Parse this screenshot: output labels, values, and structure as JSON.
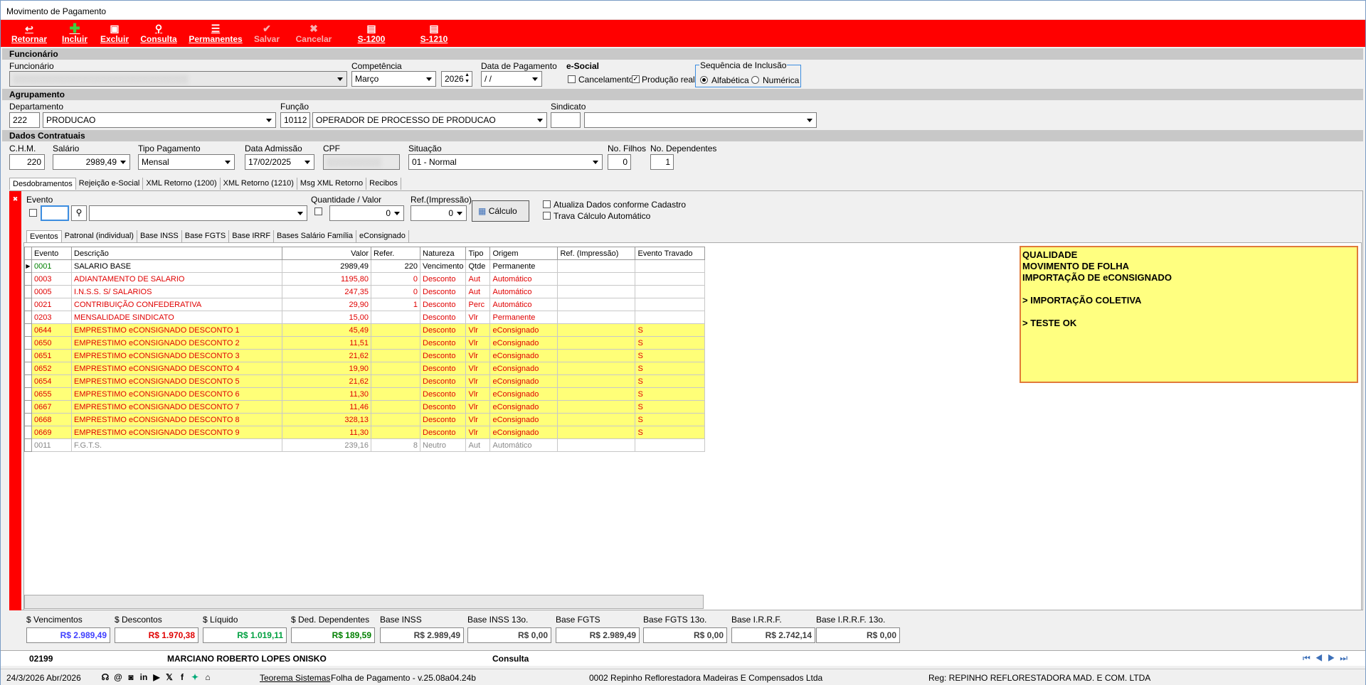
{
  "window": {
    "title": "Movimento de Pagamento"
  },
  "toolbar": {
    "items": [
      {
        "label": "Retornar",
        "icon": "return-icon"
      },
      {
        "label": "Incluir",
        "icon": "plus-icon"
      },
      {
        "label": "Excluir",
        "icon": "delete-icon"
      },
      {
        "label": "Consulta",
        "icon": "search-icon"
      },
      {
        "label": "Permanentes",
        "icon": "list-icon"
      },
      {
        "label": "Salvar",
        "icon": "check-icon"
      },
      {
        "label": "Cancelar",
        "icon": "cancel-icon"
      },
      {
        "label": "S-1200",
        "icon": "document-icon"
      },
      {
        "label": "S-1210",
        "icon": "document-icon"
      }
    ]
  },
  "funcionario": {
    "section": "Funcionário",
    "label": "Funcionário",
    "competencia_label": "Competência",
    "competencia": "Março",
    "ano": "2026",
    "data_pag_label": "Data de Pagamento",
    "data_pag": " /  /",
    "esocial_label": "e-Social",
    "cancelamento": "Cancelamento",
    "producao": "Produção real",
    "seq_label": "Sequência de Inclusão",
    "seq_alfa": "Alfabética",
    "seq_num": "Numérica"
  },
  "agrupamento": {
    "section": "Agrupamento",
    "dep_label": "Departamento",
    "dep_code": "222",
    "dep_name": "PRODUCAO",
    "funcao_label": "Função",
    "funcao_code": "10112",
    "funcao_name": "OPERADOR DE PROCESSO DE PRODUCAO",
    "sindicato_label": "Sindicato"
  },
  "contratuais": {
    "section": "Dados Contratuais",
    "chm_label": "C.H.M.",
    "chm": "220",
    "salario_label": "Salário",
    "salario": "2989,49",
    "tipo_label": "Tipo Pagamento",
    "tipo": "Mensal",
    "adm_label": "Data Admissão",
    "adm": "17/02/2025",
    "cpf_label": "CPF",
    "sit_label": "Situação",
    "sit": "01 - Normal",
    "filhos_label": "No. Filhos",
    "filhos": "0",
    "dep_label": "No. Dependentes",
    "dep": "1"
  },
  "tabs": [
    "Desdobramentos",
    "Rejeição e-Social",
    "XML Retorno (1200)",
    "XML Retorno (1210)",
    "Msg XML Retorno",
    "Recibos"
  ],
  "evento": {
    "label": "Evento",
    "qv_label": "Quantidade / Valor",
    "qv": "0",
    "ref_label": "Ref.(Impressão)",
    "ref": "0",
    "calc": "Cálculo",
    "atualiza": "Atualiza Dados conforme Cadastro",
    "trava": "Trava Cálculo Automático"
  },
  "subtabs": [
    "Eventos",
    "Patronal (individual)",
    "Base INSS",
    "Base FGTS",
    "Base IRRF",
    "Bases Salário Família",
    "eConsignado"
  ],
  "grid": {
    "headers": [
      "Evento",
      "Descrição",
      "Valor",
      "Refer.",
      "Natureza",
      "Tipo",
      "Origem",
      "Ref. (Impressão)",
      "Evento Travado"
    ],
    "rows": [
      [
        "0001",
        "SALARIO BASE",
        "2989,49",
        "220",
        "Vencimento",
        "Qtde",
        "Permanente",
        "",
        ""
      ],
      [
        "0003",
        "ADIANTAMENTO DE SALARIO",
        "1195,80",
        "0",
        "Desconto",
        "Aut",
        "Automático",
        "",
        ""
      ],
      [
        "0005",
        "I.N.S.S. S/ SALARIOS",
        "247,35",
        "0",
        "Desconto",
        "Aut",
        "Automático",
        "",
        ""
      ],
      [
        "0021",
        "CONTRIBUIÇÃO CONFEDERATIVA",
        "29,90",
        "1",
        "Desconto",
        "Perc",
        "Automático",
        "",
        ""
      ],
      [
        "0203",
        "MENSALIDADE SINDICATO",
        "15,00",
        "",
        "Desconto",
        "Vlr",
        "Permanente",
        "",
        ""
      ],
      [
        "0644",
        "EMPRESTIMO eCONSIGNADO DESCONTO  1",
        "45,49",
        "",
        "Desconto",
        "Vlr",
        "eConsignado",
        "",
        "S"
      ],
      [
        "0650",
        "EMPRESTIMO eCONSIGNADO DESCONTO  2",
        "11,51",
        "",
        "Desconto",
        "Vlr",
        "eConsignado",
        "",
        "S"
      ],
      [
        "0651",
        "EMPRESTIMO eCONSIGNADO DESCONTO  3",
        "21,62",
        "",
        "Desconto",
        "Vlr",
        "eConsignado",
        "",
        "S"
      ],
      [
        "0652",
        "EMPRESTIMO eCONSIGNADO DESCONTO  4",
        "19,90",
        "",
        "Desconto",
        "Vlr",
        "eConsignado",
        "",
        "S"
      ],
      [
        "0654",
        "EMPRESTIMO eCONSIGNADO DESCONTO  5",
        "21,62",
        "",
        "Desconto",
        "Vlr",
        "eConsignado",
        "",
        "S"
      ],
      [
        "0655",
        "EMPRESTIMO eCONSIGNADO DESCONTO  6",
        "11,30",
        "",
        "Desconto",
        "Vlr",
        "eConsignado",
        "",
        "S"
      ],
      [
        "0667",
        "EMPRESTIMO eCONSIGNADO DESCONTO  7",
        "11,46",
        "",
        "Desconto",
        "Vlr",
        "eConsignado",
        "",
        "S"
      ],
      [
        "0668",
        "EMPRESTIMO eCONSIGNADO DESCONTO  8",
        "328,13",
        "",
        "Desconto",
        "Vlr",
        "eConsignado",
        "",
        "S"
      ],
      [
        "0669",
        "EMPRESTIMO eCONSIGNADO DESCONTO  9",
        "11,30",
        "",
        "Desconto",
        "Vlr",
        "eConsignado",
        "",
        "S"
      ],
      [
        "0011",
        "F.G.T.S.",
        "239,16",
        "8",
        "Neutro",
        "Aut",
        "Automático",
        "",
        ""
      ]
    ]
  },
  "note": [
    "QUALIDADE",
    "MOVIMENTO DE FOLHA",
    "IMPORTAÇÃO DE eCONSIGNADO",
    "",
    "> IMPORTAÇÃO COLETIVA",
    "",
    "> TESTE OK"
  ],
  "totals": [
    {
      "label": "$ Vencimentos",
      "value": "R$ 2.989,49",
      "color": "#4040ff"
    },
    {
      "label": "$ Descontos",
      "value": "R$ 1.970,38",
      "color": "#e00000"
    },
    {
      "label": "$ Líquido",
      "value": "R$ 1.019,11",
      "color": "#00a040"
    },
    {
      "label": "$ Ded. Dependentes",
      "value": "R$ 189,59",
      "color": "#008000"
    },
    {
      "label": "Base INSS",
      "value": "R$ 2.989,49",
      "color": "#404040"
    },
    {
      "label": "Base INSS 13o.",
      "value": "R$ 0,00",
      "color": "#404040"
    },
    {
      "label": "Base FGTS",
      "value": "R$ 2.989,49",
      "color": "#404040"
    },
    {
      "label": "Base FGTS 13o.",
      "value": "R$ 0,00",
      "color": "#404040"
    },
    {
      "label": "Base I.R.R.F.",
      "value": "R$ 2.742,14",
      "color": "#404040"
    },
    {
      "label": "Base I.R.R.F. 13o.",
      "value": "R$ 0,00",
      "color": "#404040"
    }
  ],
  "record": {
    "code": "02199",
    "name": "MARCIANO ROBERTO LOPES ONISKO",
    "mode": "Consulta"
  },
  "statusbar": {
    "date": "24/3/2026 Abr/2026",
    "company_link": "Teorema Sistemas",
    "version": "Folha de Pagamento - v.25.08a04.24b",
    "company": "0002 Repinho Reflorestadora Madeiras E Compensados Ltda",
    "reg": "Reg: REPINHO REFLORESTADORA MAD. E COM. LTDA"
  }
}
